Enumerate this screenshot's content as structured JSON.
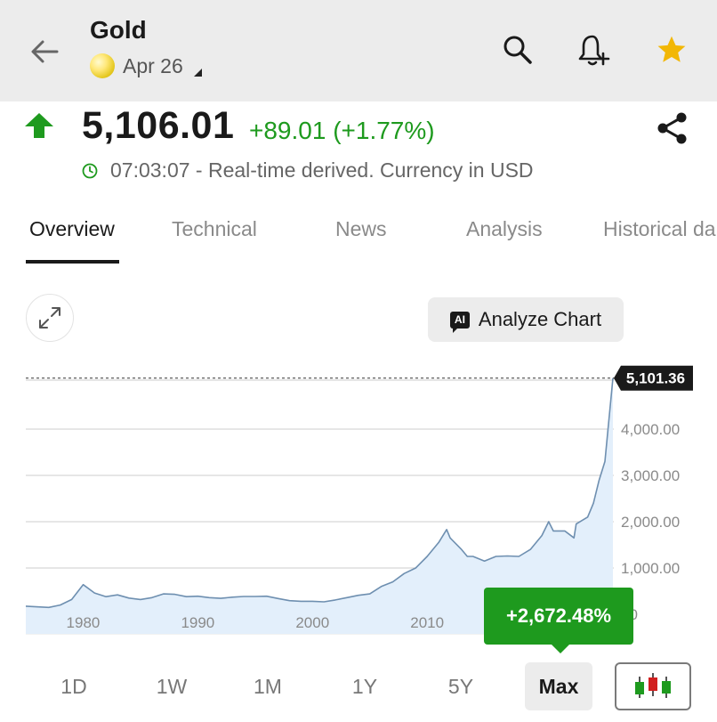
{
  "header": {
    "title": "Gold",
    "contract": "Apr 26"
  },
  "quote": {
    "price": "5,106.01",
    "change": "+89.01 (+1.77%)",
    "time_status": "07:03:07 - Real-time derived. Currency in USD"
  },
  "tabs": [
    {
      "label": "Overview",
      "active": true
    },
    {
      "label": "Technical"
    },
    {
      "label": "News"
    },
    {
      "label": "Analysis"
    },
    {
      "label": "Historical da"
    }
  ],
  "analyze": {
    "badge": "AI",
    "label": "Analyze Chart"
  },
  "performance": "+2,672.48%",
  "ranges": [
    "1D",
    "1W",
    "1M",
    "1Y",
    "5Y",
    "Max"
  ],
  "selected_range": "Max",
  "colors": {
    "positive": "#1e9a1e",
    "line": "#6e8fb0",
    "fill": "#e3effb",
    "star": "#f2b705"
  },
  "icons": [
    "back-arrow-icon",
    "search-icon",
    "bell-plus-icon",
    "star-icon",
    "up-arrow-icon",
    "share-icon",
    "clock-icon",
    "expand-icon",
    "candlestick-icon"
  ],
  "chart_data": {
    "type": "area",
    "x": [
      1975,
      1977,
      1978,
      1979,
      1980,
      1981,
      1982,
      1983,
      1984,
      1985,
      1986,
      1987,
      1988,
      1989,
      1990,
      1991,
      1992,
      1993,
      1994,
      1995,
      1996,
      1997,
      1998,
      1999,
      2000,
      2001,
      2002,
      2003,
      2004,
      2005,
      2006,
      2007,
      2008,
      2009,
      2010,
      2011,
      2011.7,
      2012,
      2013,
      2013.5,
      2014,
      2015,
      2016,
      2017,
      2018,
      2019,
      2020,
      2020.6,
      2021,
      2022,
      2022.8,
      2023,
      2024,
      2024.5,
      2025,
      2025.5,
      2026.2
    ],
    "y": [
      175,
      148,
      200,
      320,
      640,
      460,
      380,
      420,
      350,
      320,
      360,
      440,
      430,
      380,
      390,
      360,
      345,
      370,
      385,
      385,
      390,
      340,
      295,
      280,
      280,
      270,
      310,
      360,
      410,
      440,
      600,
      700,
      880,
      1000,
      1250,
      1550,
      1830,
      1650,
      1400,
      1250,
      1250,
      1150,
      1250,
      1260,
      1250,
      1400,
      1700,
      2000,
      1800,
      1800,
      1650,
      1950,
      2100,
      2400,
      2900,
      3300,
      5101.36
    ],
    "xaxis_ticks": [
      1980,
      1990,
      2000,
      2010
    ],
    "yaxis_ticks": [
      "4,000.00",
      "3,000.00",
      "2,000.00",
      "1,000.00",
      "00"
    ],
    "last_value_label": "5,101.36",
    "xlim": [
      1975,
      2026.2
    ],
    "ylim": [
      0,
      5101.36
    ],
    "grid": true
  }
}
